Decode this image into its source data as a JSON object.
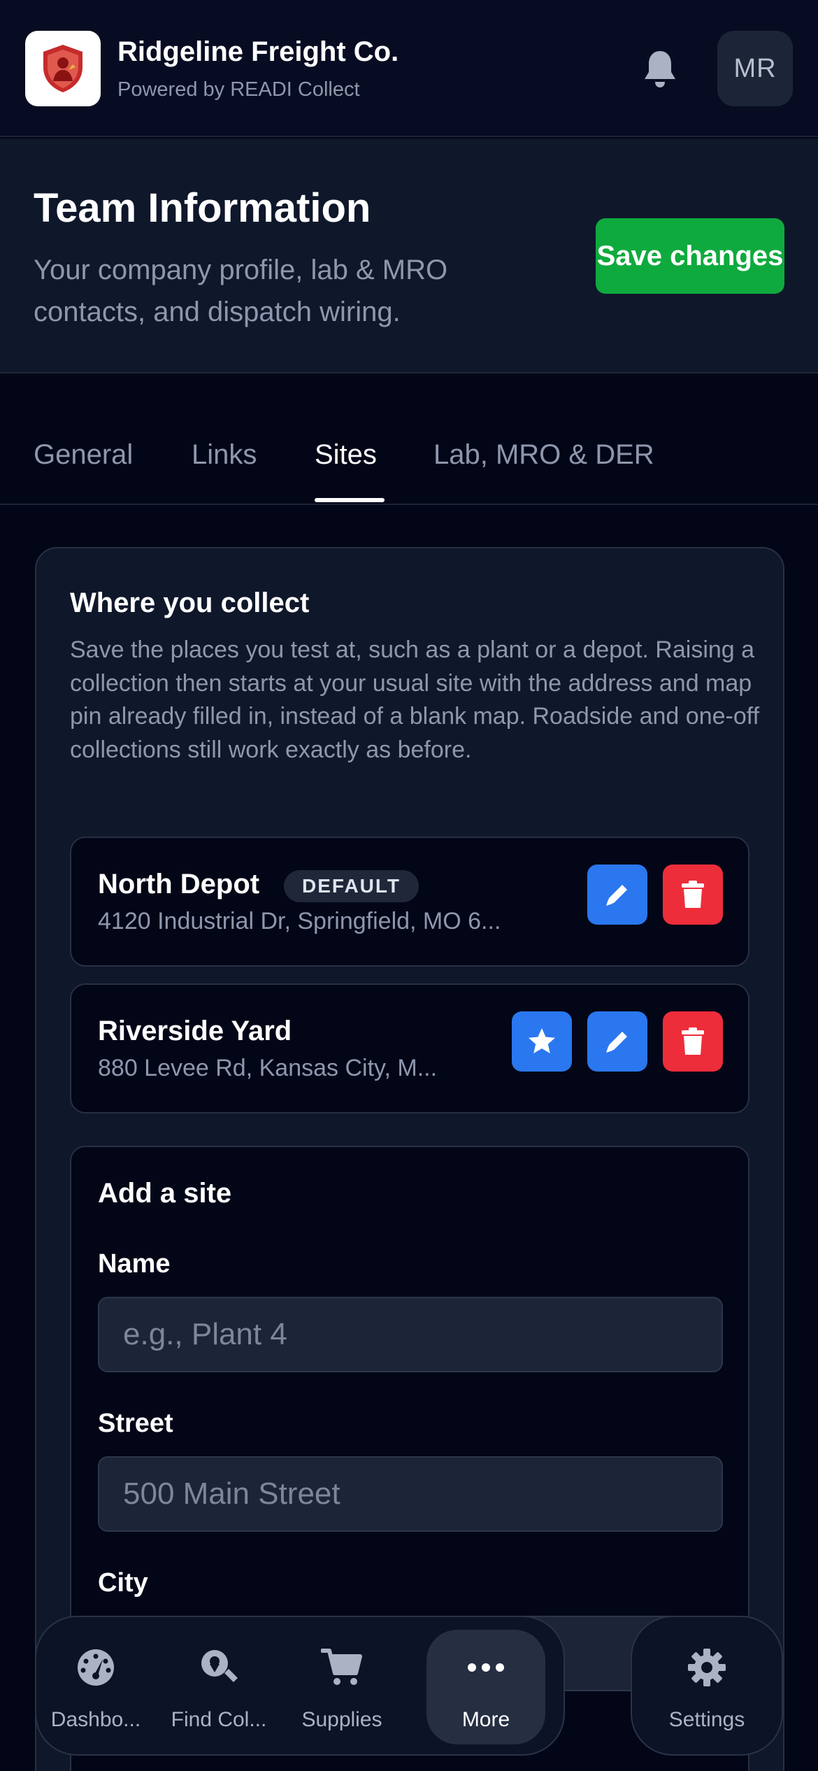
{
  "header": {
    "company": "Ridgeline Freight Co.",
    "powered_by": "Powered by READI Collect",
    "avatar_initials": "MR"
  },
  "page": {
    "title": "Team Information",
    "subtitle": "Your company profile, lab & MRO contacts, and dispatch wiring.",
    "save_label": "Save changes"
  },
  "tabs": [
    {
      "label": "General"
    },
    {
      "label": "Links"
    },
    {
      "label": "Sites",
      "active": true
    },
    {
      "label": "Lab, MRO & DER"
    }
  ],
  "sites_section": {
    "title": "Where you collect",
    "description": "Save the places you test at, such as a plant or a depot. Raising a collection then starts at your usual site with the address and map pin already filled in, instead of a blank map. Roadside and one-off collections still work exactly as before.",
    "sites": [
      {
        "name": "North Depot",
        "badge": "DEFAULT",
        "address": "4120 Industrial Dr, Springfield, MO 6..."
      },
      {
        "name": "Riverside Yard",
        "address": "880 Levee Rd, Kansas City, M..."
      }
    ],
    "add_form": {
      "title": "Add a site",
      "name_label": "Name",
      "name_placeholder": "e.g., Plant 4",
      "street_label": "Street",
      "street_placeholder": "500 Main Street",
      "city_label": "City"
    }
  },
  "nav": {
    "items": [
      {
        "label": "Dashbo...",
        "icon": "gauge-icon"
      },
      {
        "label": "Find Col...",
        "icon": "search-location-icon"
      },
      {
        "label": "Supplies",
        "icon": "cart-icon"
      },
      {
        "label": "More",
        "icon": "ellipsis-icon",
        "active": true
      }
    ],
    "settings_label": "Settings"
  },
  "colors": {
    "background": "#030617",
    "surface": "#0f172a",
    "save_green": "#0faa3e",
    "action_blue": "#2a77ef",
    "danger_red": "#ee2d3a"
  }
}
